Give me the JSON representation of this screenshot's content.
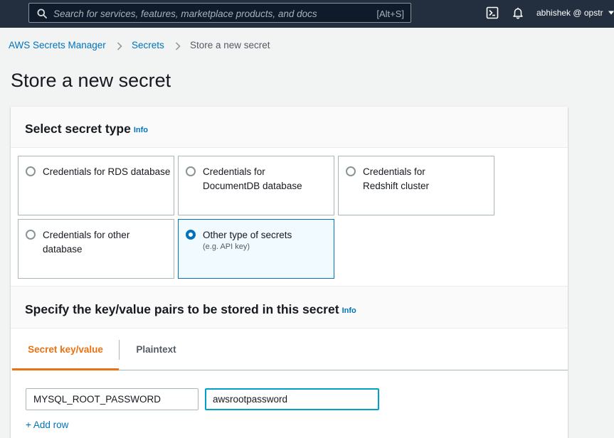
{
  "topnav": {
    "search_placeholder": "Search for services, features, marketplace products, and docs",
    "search_shortcut": "[Alt+S]",
    "user_label": "abhishek @ opstr",
    "icons": [
      "search-icon",
      "cloudshell-icon",
      "bell-icon",
      "caret-down-icon"
    ]
  },
  "breadcrumb": {
    "items": [
      "AWS Secrets Manager",
      "Secrets"
    ],
    "current": "Store a new secret"
  },
  "page": {
    "title": "Store a new secret"
  },
  "secret_type": {
    "heading": "Select secret type",
    "info": "Info",
    "options": [
      {
        "label": "Credentials for RDS database",
        "description": "",
        "selected": false
      },
      {
        "label": "Credentials for DocumentDB database",
        "description": "",
        "selected": false
      },
      {
        "label": "Credentials for Redshift cluster",
        "description": "",
        "selected": false
      },
      {
        "label": "Credentials for other database",
        "description": "",
        "selected": false
      },
      {
        "label": "Other type of secrets",
        "description": "(e.g. API key)",
        "selected": true
      }
    ]
  },
  "kv_section": {
    "heading": "Specify the key/value pairs to be stored in this secret",
    "info": "Info",
    "tabs": [
      {
        "label": "Secret key/value",
        "active": true
      },
      {
        "label": "Plaintext",
        "active": false
      }
    ],
    "rows": [
      {
        "key": "MYSQL_ROOT_PASSWORD",
        "value": "awsrootpassword"
      }
    ],
    "add_row_label": "+ Add row"
  },
  "colors": {
    "nav_bg": "#232f3e",
    "link": "#0073bb",
    "active_tab": "#ec7211",
    "selected_tile_border": "#0073bb",
    "focus_ring": "#00a1c9"
  }
}
